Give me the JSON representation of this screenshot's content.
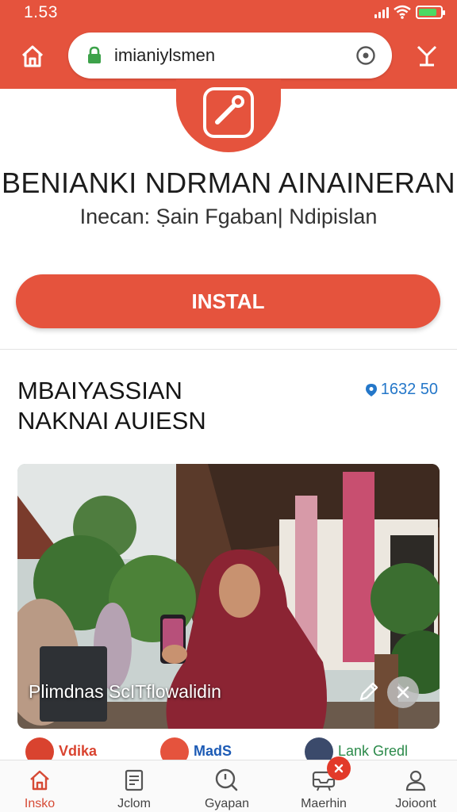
{
  "status_bar": {
    "time": "1.53"
  },
  "browser": {
    "url": "imianiylsmen"
  },
  "app": {
    "title": "BENIANKI NDRMAN AINAINERAN",
    "subtitle": "Inecan: Ṣain Fgaban| Ndipislan",
    "install_label": "INSTAL"
  },
  "section": {
    "title": "MBAIYASSIAN NAKNAI AUIESN",
    "count": "1632 50"
  },
  "photo": {
    "caption": "Plimdnas ScITflowalidin"
  },
  "suggestions": [
    {
      "label": "Vdika",
      "color": "#d9432f"
    },
    {
      "label": "MadS",
      "color": "#1d5bb5"
    },
    {
      "label": "Lank Gredl",
      "color": "#2b8a4a"
    }
  ],
  "bottom_nav": [
    {
      "label": "Insko",
      "icon": "home-icon",
      "active": true
    },
    {
      "label": "Jclom",
      "icon": "document-icon",
      "active": false
    },
    {
      "label": "Gyapan",
      "icon": "search-icon",
      "active": false
    },
    {
      "label": "Maerhin",
      "icon": "inbox-icon",
      "active": false
    },
    {
      "label": "Joioont",
      "icon": "profile-icon",
      "active": false
    }
  ],
  "colors": {
    "accent": "#e5533d",
    "link": "#2477c9",
    "background": "#ffffff"
  }
}
